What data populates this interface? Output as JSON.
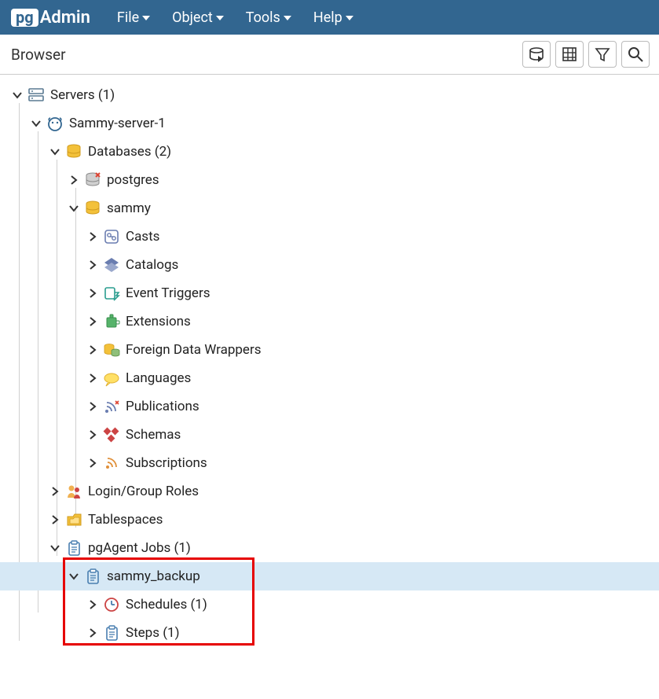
{
  "logo": {
    "box": "pg",
    "rest": "Admin"
  },
  "menu": {
    "file": "File",
    "object": "Object",
    "tools": "Tools",
    "help": "Help"
  },
  "browser": {
    "title": "Browser"
  },
  "tree": {
    "servers": "Servers (1)",
    "server1": "Sammy-server-1",
    "databases": "Databases (2)",
    "db_postgres": "postgres",
    "db_sammy": "sammy",
    "casts": "Casts",
    "catalogs": "Catalogs",
    "event_triggers": "Event Triggers",
    "extensions": "Extensions",
    "fdw": "Foreign Data Wrappers",
    "languages": "Languages",
    "publications": "Publications",
    "schemas": "Schemas",
    "subscriptions": "Subscriptions",
    "login_roles": "Login/Group Roles",
    "tablespaces": "Tablespaces",
    "pgagent_jobs": "pgAgent Jobs (1)",
    "sammy_backup": "sammy_backup",
    "schedules": "Schedules (1)",
    "steps": "Steps (1)"
  }
}
